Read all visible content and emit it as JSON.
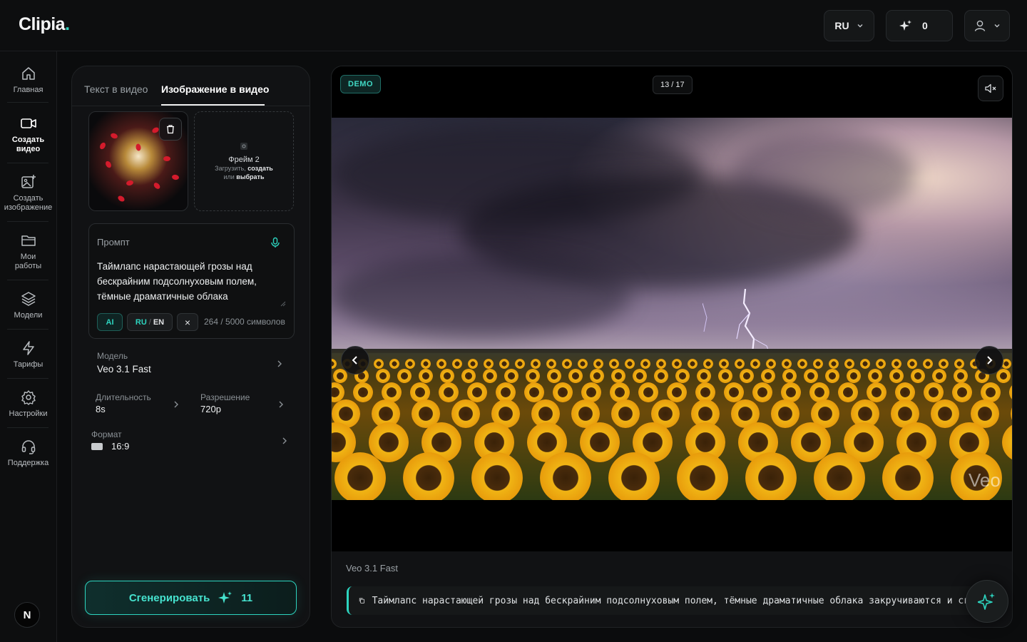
{
  "app": {
    "logo": "Clipia",
    "logo_dot": "."
  },
  "topbar": {
    "language": "RU",
    "credits": "0"
  },
  "sidebar": {
    "items": [
      {
        "label": "Главная",
        "icon": "home-icon"
      },
      {
        "label": "Создать видео",
        "icon": "video-camera-icon"
      },
      {
        "label": "Создать изображение",
        "icon": "image-plus-icon"
      },
      {
        "label": "Мои работы",
        "icon": "folder-icon"
      },
      {
        "label": "Модели",
        "icon": "layers-icon"
      },
      {
        "label": "Тарифы",
        "icon": "lightning-icon"
      },
      {
        "label": "Настройки",
        "icon": "gear-icon"
      },
      {
        "label": "Поддержка",
        "icon": "headset-icon"
      }
    ],
    "user_initial": "N"
  },
  "panel": {
    "tabs": [
      {
        "label": "Текст в видео"
      },
      {
        "label": "Изображение в видео"
      }
    ],
    "frame2": {
      "title": "Фрейм 2",
      "line1_prefix": "Загрузить,",
      "line1_link": "создать",
      "line2_prefix": "или",
      "line2_link": "выбрать"
    },
    "prompt": {
      "label": "Промпт",
      "text": "Таймлапс нарастающей грозы над бескрайним подсолнуховым полем, тёмные драматичные облака",
      "chip_ai": "AI",
      "chip_lang_a": "RU",
      "chip_lang_sep": "/",
      "chip_lang_b": "EN",
      "chip_clear": "×",
      "counter": "264 / 5000 символов"
    },
    "model": {
      "label": "Модель",
      "value": "Veo 3.1 Fast"
    },
    "duration": {
      "label": "Длительность",
      "value": "8s"
    },
    "resolution": {
      "label": "Разрешение",
      "value": "720p"
    },
    "format": {
      "label": "Формат",
      "value": "16:9"
    },
    "generate": {
      "label": "Сгенерировать",
      "cost": "11"
    }
  },
  "viewer": {
    "demo_badge": "DEMO",
    "counter": "13 / 17",
    "watermark": "Veo",
    "model": "Veo 3.1 Fast",
    "caption": "Таймлапс нарастающей грозы над бескрайним подсолнуховым полем, тёмные драматичные облака закручиваются и сгуща..."
  },
  "colors": {
    "accent": "#2dd4bf",
    "background": "#0b0c0d",
    "panel": "#111214"
  }
}
